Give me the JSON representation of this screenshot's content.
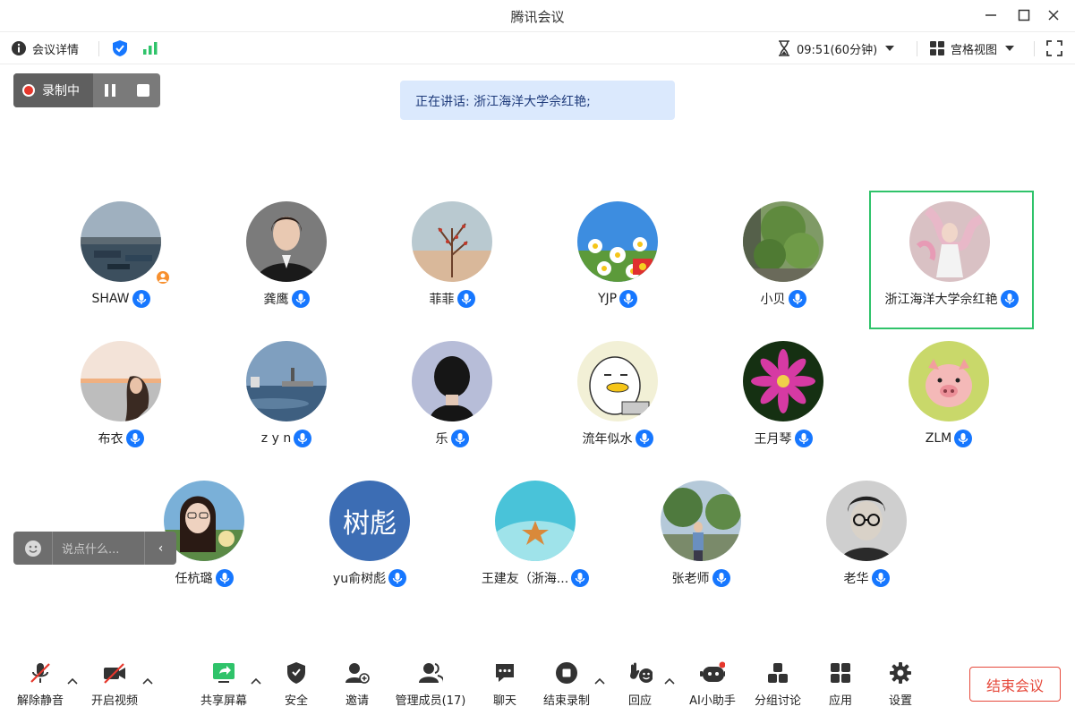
{
  "window": {
    "title": "腾讯会议"
  },
  "infobar": {
    "meeting_details": "会议详情",
    "time": "09:51(60分钟)",
    "view": "宫格视图"
  },
  "recording": {
    "label": "录制中"
  },
  "speaking": {
    "text": "正在讲话: 浙江海洋大学佘红艳;"
  },
  "participants": [
    {
      "name": "SHAW",
      "avatar": "lake-photo"
    },
    {
      "name": "龚鹰",
      "avatar": "portrait-photo"
    },
    {
      "name": "菲菲",
      "avatar": "branch-photo"
    },
    {
      "name": "YJP",
      "avatar": "daisy-photo"
    },
    {
      "name": "小贝",
      "avatar": "garden-photo"
    },
    {
      "name": "浙江海洋大学佘红艳",
      "avatar": "pink-photo"
    },
    {
      "name": "布衣",
      "avatar": "sunset-photo"
    },
    {
      "name": "z y n",
      "avatar": "harbor-photo"
    },
    {
      "name": "乐",
      "avatar": "silhouette-photo"
    },
    {
      "name": "流年似水",
      "avatar": "duck-cartoon"
    },
    {
      "name": "王月琴",
      "avatar": "flower-photo"
    },
    {
      "name": "ZLM",
      "avatar": "pig-cartoon"
    },
    {
      "name": "任杭璐",
      "avatar": "selfie-photo"
    },
    {
      "name": "yu俞树彪",
      "avatar": "text-avatar",
      "avatar_text": "树彪"
    },
    {
      "name": "王建友（浙海...",
      "avatar": "starfish-photo"
    },
    {
      "name": "张老师",
      "avatar": "tree-photo"
    },
    {
      "name": "老华",
      "avatar": "bw-portrait"
    }
  ],
  "chat": {
    "placeholder": "说点什么...",
    "collapse": "‹"
  },
  "toolbar": {
    "unmute": "解除静音",
    "start_video": "开启视频",
    "share_screen": "共享屏幕",
    "security": "安全",
    "invite": "邀请",
    "manage_members": "管理成员(17)",
    "chat": "聊天",
    "end_recording": "结束录制",
    "reactions": "回应",
    "ai_assistant": "AI小助手",
    "breakout": "分组讨论",
    "apps": "应用",
    "settings": "设置",
    "end_meeting": "结束会议"
  },
  "colors": {
    "accent_blue": "#1677ff",
    "active_border": "#2fc36a",
    "end_red": "#e6493b",
    "record_red": "#e6372c"
  }
}
